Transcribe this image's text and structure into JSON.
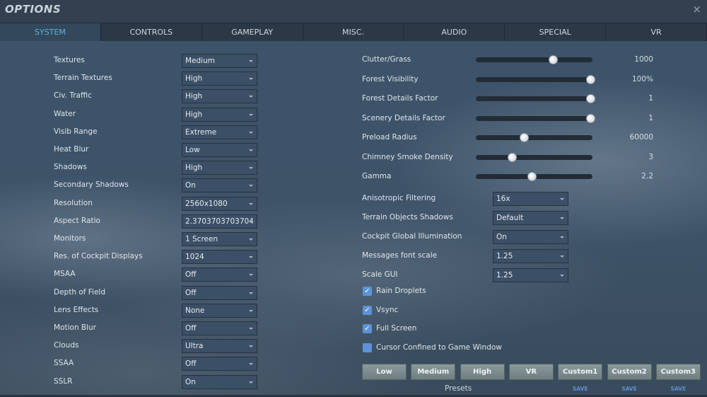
{
  "window": {
    "title": "OPTIONS",
    "close": "×"
  },
  "tabs": [
    "SYSTEM",
    "CONTROLS",
    "GAMEPLAY",
    "MISC.",
    "AUDIO",
    "SPECIAL",
    "VR"
  ],
  "left_settings": [
    {
      "label": "Textures",
      "value": "Medium"
    },
    {
      "label": "Terrain Textures",
      "value": "High"
    },
    {
      "label": "Civ. Traffic",
      "value": "High"
    },
    {
      "label": "Water",
      "value": "High"
    },
    {
      "label": "Visib Range",
      "value": "Extreme"
    },
    {
      "label": "Heat Blur",
      "value": "Low"
    },
    {
      "label": "Shadows",
      "value": "High"
    },
    {
      "label": "Secondary Shadows",
      "value": "On"
    },
    {
      "label": "Resolution",
      "value": "2560x1080"
    },
    {
      "label": "Aspect Ratio",
      "value": "2.3703703703704"
    },
    {
      "label": "Monitors",
      "value": "1 Screen"
    },
    {
      "label": "Res. of Cockpit Displays",
      "value": "1024"
    },
    {
      "label": "MSAA",
      "value": "Off"
    },
    {
      "label": "Depth of Field",
      "value": "Off"
    },
    {
      "label": "Lens Effects",
      "value": "None"
    },
    {
      "label": "Motion Blur",
      "value": "Off"
    },
    {
      "label": "Clouds",
      "value": "Ultra"
    },
    {
      "label": "SSAA",
      "value": "Off"
    },
    {
      "label": "SSLR",
      "value": "On"
    }
  ],
  "sliders": [
    {
      "label": "Clutter/Grass",
      "value": "1000",
      "fraction": 0.66
    },
    {
      "label": "Forest Visibility",
      "value": "100%",
      "fraction": 0.98
    },
    {
      "label": "Forest Details Factor",
      "value": "1",
      "fraction": 0.98
    },
    {
      "label": "Scenery Details Factor",
      "value": "1",
      "fraction": 0.98
    },
    {
      "label": "Preload Radius",
      "value": "60000",
      "fraction": 0.41
    },
    {
      "label": "Chimney Smoke Density",
      "value": "3",
      "fraction": 0.31
    },
    {
      "label": "Gamma",
      "value": "2.2",
      "fraction": 0.48
    }
  ],
  "right_dropdowns": [
    {
      "label": "Anisotropic Filtering",
      "value": "16x"
    },
    {
      "label": "Terrain Objects Shadows",
      "value": "Default"
    },
    {
      "label": "Cockpit Global Illumination",
      "value": "On"
    },
    {
      "label": "Messages font scale",
      "value": "1.25"
    },
    {
      "label": "Scale GUI",
      "value": "1.25"
    }
  ],
  "checkboxes": [
    {
      "label": "Rain Droplets",
      "checked": true
    },
    {
      "label": "Vsync",
      "checked": true
    },
    {
      "label": "Full Screen",
      "checked": true
    },
    {
      "label": "Cursor Confined to Game Window",
      "checked": false
    }
  ],
  "presets": {
    "label": "Presets",
    "buttons": [
      "Low",
      "Medium",
      "High",
      "VR",
      "Custom1",
      "Custom2",
      "Custom3"
    ],
    "save_label": "SAVE"
  }
}
